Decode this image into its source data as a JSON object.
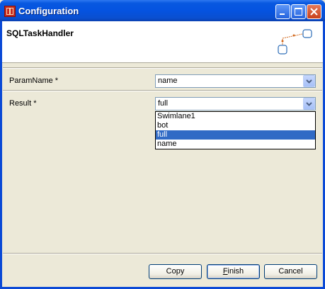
{
  "window": {
    "title": "Configuration",
    "controls": [
      "minimize-icon",
      "maximize-icon",
      "close-icon"
    ]
  },
  "header": {
    "title": "SQLTaskHandler"
  },
  "fields": {
    "param_name": {
      "label": "ParamName *",
      "value": "name"
    },
    "result": {
      "label": "Result *",
      "value": "full"
    }
  },
  "dropdown": {
    "options": [
      "Swimlane1",
      "bot",
      "full",
      "name"
    ],
    "selected": "full"
  },
  "buttons": {
    "copy": "Copy",
    "finish_mnemonic": "F",
    "finish_rest": "inish",
    "cancel": "Cancel"
  },
  "colors": {
    "titlebar": "#0553e0",
    "selection": "#316ac5",
    "dialog_bg": "#ece9d8"
  }
}
